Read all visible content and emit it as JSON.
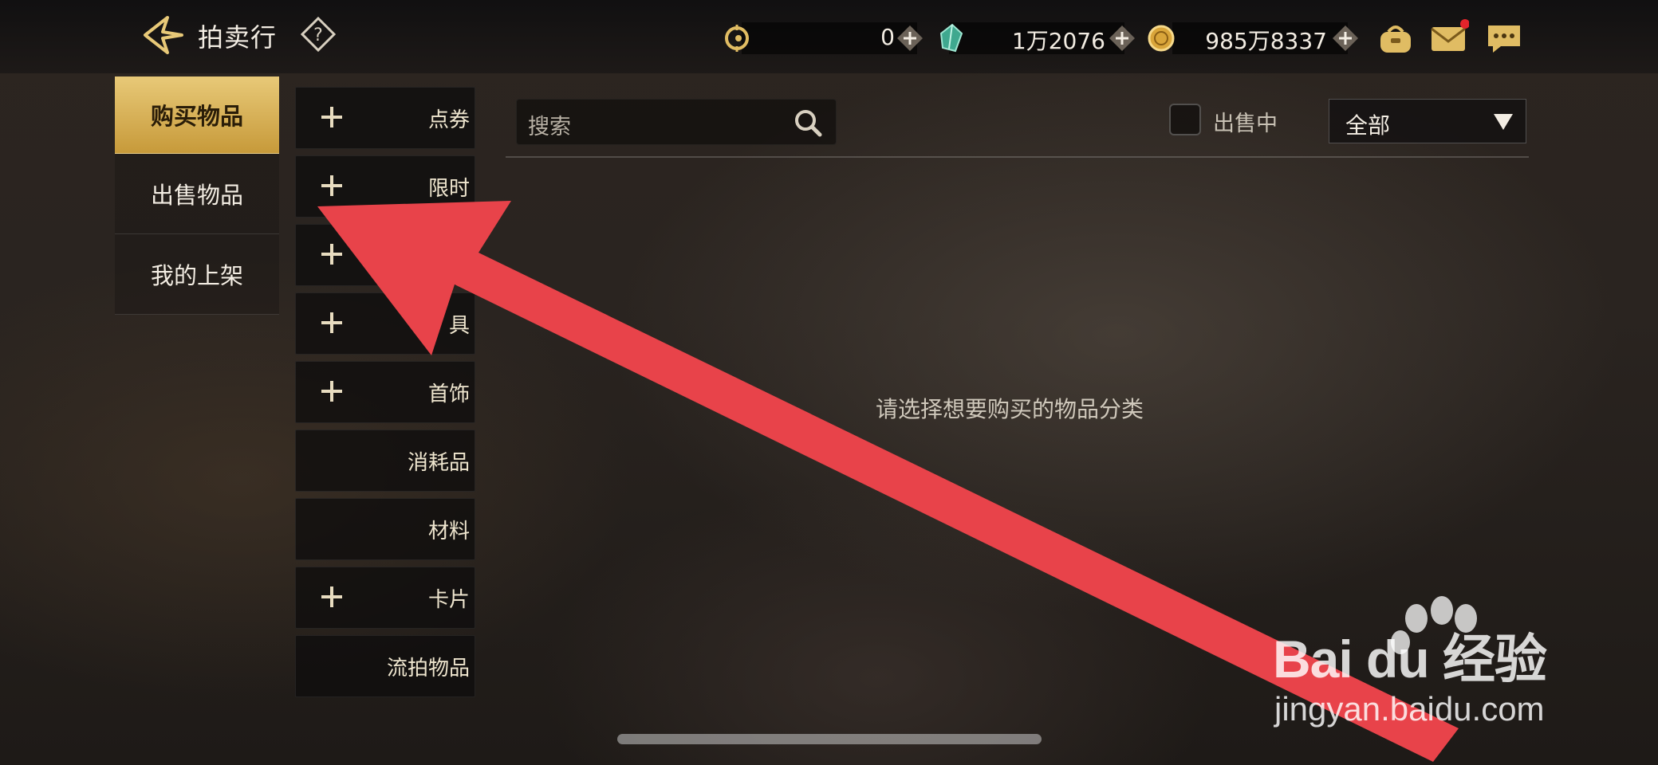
{
  "header": {
    "title": "拍卖行",
    "currencies": [
      {
        "icon": "coupon-currency-icon",
        "value": "0"
      },
      {
        "icon": "crystal-currency-icon",
        "value": "1万2076"
      },
      {
        "icon": "gold-coin-icon",
        "value": "985万8337"
      }
    ],
    "icons": [
      "bag-icon",
      "mail-icon",
      "chat-icon"
    ]
  },
  "left_menu": {
    "items": [
      {
        "label": "购买物品",
        "active": true
      },
      {
        "label": "出售物品",
        "active": false
      },
      {
        "label": "我的上架",
        "active": false
      }
    ]
  },
  "categories": [
    {
      "label": "点券",
      "expandable": true
    },
    {
      "label": "限时",
      "expandable": true
    },
    {
      "label": "",
      "expandable": true
    },
    {
      "label": "具",
      "expandable": true
    },
    {
      "label": "首饰",
      "expandable": true
    },
    {
      "label": "消耗品",
      "expandable": false
    },
    {
      "label": "材料",
      "expandable": false
    },
    {
      "label": "卡片",
      "expandable": true
    },
    {
      "label": "流拍物品",
      "expandable": false
    }
  ],
  "search": {
    "placeholder": "搜索"
  },
  "filter": {
    "checkbox_label": "出售中",
    "checked": false,
    "dropdown_value": "全部"
  },
  "main": {
    "empty_message": "请选择想要购买的物品分类"
  },
  "watermark": {
    "brand": "Bai du 经验",
    "url": "jingyan.baidu.com"
  },
  "colors": {
    "accent_gold": "#e0bc63",
    "annotation_red": "#e8434a"
  }
}
